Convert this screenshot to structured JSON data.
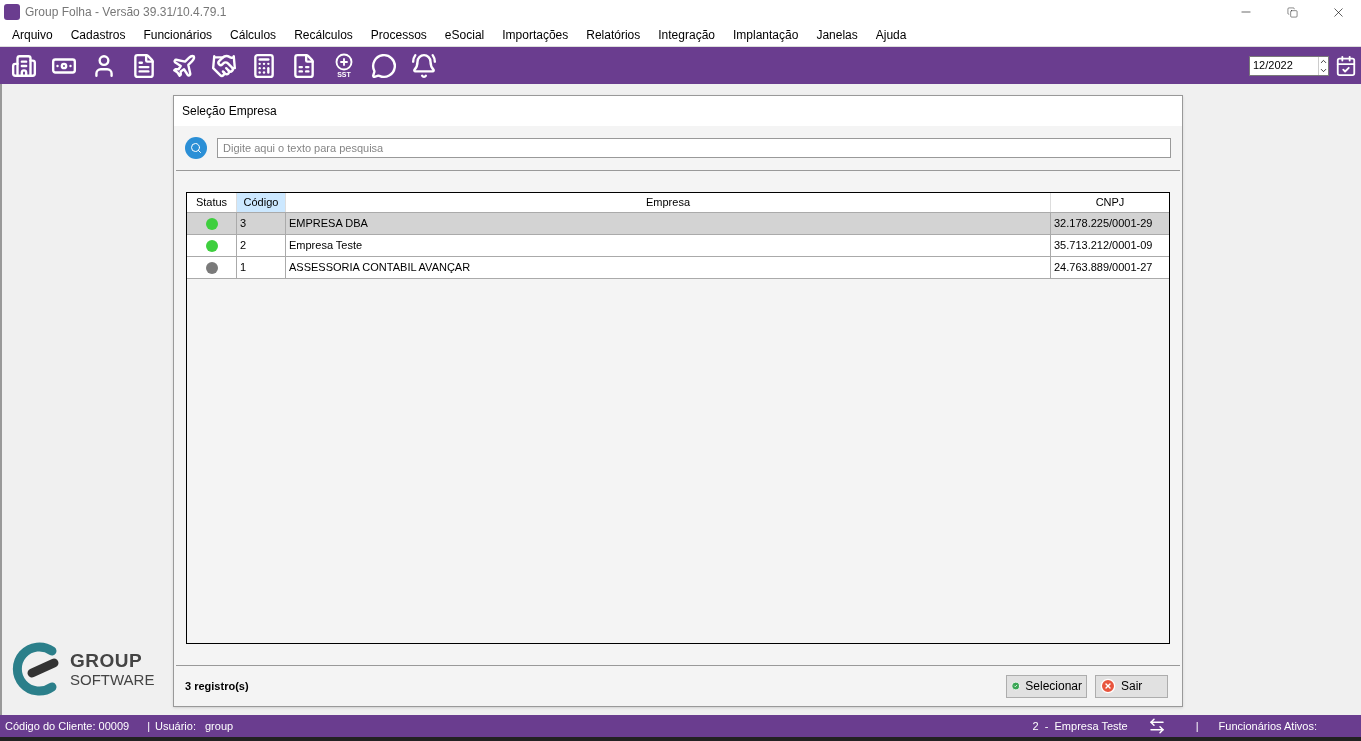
{
  "window": {
    "title": "Group Folha - Versão 39.31/10.4.79.1"
  },
  "menu": [
    "Arquivo",
    "Cadastros",
    "Funcionários",
    "Cálculos",
    "Recálculos",
    "Processos",
    "eSocial",
    "Importações",
    "Relatórios",
    "Integração",
    "Implantação",
    "Janelas",
    "Ajuda"
  ],
  "toolbar": {
    "tools": [
      {
        "kind": "building"
      },
      {
        "kind": "money"
      },
      {
        "kind": "user"
      },
      {
        "kind": "invoice"
      },
      {
        "kind": "plane"
      },
      {
        "kind": "handshake"
      },
      {
        "kind": "calculator"
      },
      {
        "kind": "document"
      },
      {
        "kind": "sst",
        "label": "SST"
      },
      {
        "kind": "whatsapp"
      },
      {
        "kind": "bell"
      }
    ],
    "period": "12/2022"
  },
  "logo": {
    "line1": "GROUP",
    "line2": "SOFTWARE"
  },
  "dialog": {
    "title": "Seleção Empresa",
    "search": {
      "placeholder": "Digite aqui o texto para pesquisa"
    },
    "table": {
      "columns": [
        {
          "label": "Status",
          "selected": false
        },
        {
          "label": "Código",
          "selected": true
        },
        {
          "label": "Empresa",
          "selected": false
        },
        {
          "label": "CNPJ",
          "selected": false
        }
      ],
      "rows": [
        {
          "color": "#3ecf3e",
          "code": "3",
          "company": "EMPRESA DBA",
          "cnpj": "32.178.225/0001-29",
          "selected": true
        },
        {
          "color": "#3ecf3e",
          "code": "2",
          "company": "Empresa Teste",
          "cnpj": "35.713.212/0001-09",
          "selected": false
        },
        {
          "color": "#7a7a7a",
          "code": "1",
          "company": "ASSESSORIA CONTABIL AVANÇAR",
          "cnpj": "24.763.889/0001-27",
          "selected": false
        }
      ]
    },
    "count": "3 registro(s)",
    "buttons": [
      {
        "kind": "ok",
        "label": "Selecionar"
      },
      {
        "kind": "cancel",
        "label": "Sair"
      }
    ]
  },
  "status_bar": {
    "client": "Código do Cliente: 00009",
    "sep1": "|",
    "user_label": "Usuário:",
    "user": "group",
    "company": "2  -  Empresa Teste",
    "sep2": "|",
    "employees": "Funcionários Ativos:"
  }
}
